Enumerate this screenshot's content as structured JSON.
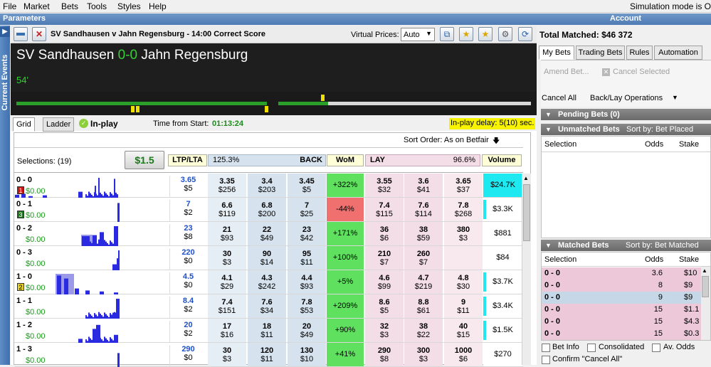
{
  "menu": {
    "items": [
      "File",
      "Market",
      "Bets",
      "Tools",
      "Styles",
      "Help"
    ],
    "simulation": "Simulation mode is O"
  },
  "header": {
    "parameters": "Parameters",
    "account": "Account"
  },
  "side": {
    "tab": "Current Events"
  },
  "market": {
    "title": "SV Sandhausen v Jahn Regensburg - 14:00 Correct Score",
    "virtual_prices_label": "Virtual Prices:",
    "virtual_prices_value": "Auto",
    "total_matched": "Total Matched: $46 372"
  },
  "score": {
    "home": "SV Sandhausen",
    "score": "0-0",
    "away": "Jahn Regensburg",
    "minute": "54'"
  },
  "tabs": {
    "grid": "Grid",
    "ladder": "Ladder",
    "inplay": "In-play",
    "time_label": "Time from Start:",
    "time_value": "01:13:24",
    "delay": "In-play delay: 5(10) sec."
  },
  "grid": {
    "sort_order": "Sort Order: As on Betfair",
    "selections": "Selections: (19)",
    "stake": "$1.5",
    "ltp": "LTP/LTA",
    "back_pct": "125.3%",
    "back": "BACK",
    "wom": "WoM",
    "lay": "LAY",
    "lay_pct": "96.6%",
    "volume": "Volume",
    "rows": [
      {
        "name": "0 - 0",
        "badge": "1",
        "badge_color": "#cc1111",
        "pl": "$0.00",
        "ltp": "3.65",
        "lta": "$5",
        "b": [
          [
            "3.35",
            "$256"
          ],
          [
            "3.4",
            "$203"
          ],
          [
            "3.45",
            "$5"
          ]
        ],
        "wom": "+322%",
        "wom_color": "#5fe05f",
        "l": [
          [
            "3.55",
            "$32"
          ],
          [
            "3.6",
            "$41"
          ],
          [
            "3.65",
            "$37"
          ]
        ],
        "vol": "$24.7K",
        "vol_hl": true,
        "vol_bar": 1.0
      },
      {
        "name": "0 - 1",
        "badge": "3",
        "badge_color": "#1a7a1a",
        "pl": "$0.00",
        "ltp": "7",
        "lta": "$2",
        "b": [
          [
            "6.6",
            "$119"
          ],
          [
            "6.8",
            "$200"
          ],
          [
            "7",
            "$25"
          ]
        ],
        "wom": "-44%",
        "wom_color": "#f07070",
        "l": [
          [
            "7.4",
            "$115"
          ],
          [
            "7.6",
            "$114"
          ],
          [
            "7.8",
            "$268"
          ]
        ],
        "vol": "$3.3K",
        "vol_hl": false,
        "vol_bar": 0.12
      },
      {
        "name": "0 - 2",
        "badge": "",
        "badge_color": "",
        "pl": "$0.00",
        "ltp": "23",
        "lta": "$8",
        "b": [
          [
            "21",
            "$93"
          ],
          [
            "22",
            "$49"
          ],
          [
            "23",
            "$42"
          ]
        ],
        "wom": "+171%",
        "wom_color": "#5fe05f",
        "l": [
          [
            "36",
            "$6"
          ],
          [
            "38",
            "$59"
          ],
          [
            "380",
            "$3"
          ]
        ],
        "vol": "$881",
        "vol_hl": false,
        "vol_bar": 0.03
      },
      {
        "name": "0 - 3",
        "badge": "",
        "badge_color": "",
        "pl": "$0.00",
        "ltp": "220",
        "lta": "$0",
        "b": [
          [
            "30",
            "$3"
          ],
          [
            "90",
            "$14"
          ],
          [
            "95",
            "$11"
          ]
        ],
        "wom": "+100%",
        "wom_color": "#5fe05f",
        "l": [
          [
            "210",
            "$7"
          ],
          [
            "260",
            "$7"
          ],
          [
            "",
            ""
          ]
        ],
        "vol": "$84",
        "vol_hl": false,
        "vol_bar": 0.0
      },
      {
        "name": "1 - 0",
        "badge": "2",
        "badge_color": "#e8d21a",
        "pl": "$0.00",
        "ltp": "4.5",
        "lta": "$0",
        "b": [
          [
            "4.1",
            "$29"
          ],
          [
            "4.3",
            "$242"
          ],
          [
            "4.4",
            "$93"
          ]
        ],
        "wom": "+5%",
        "wom_color": "#5fe05f",
        "l": [
          [
            "4.6",
            "$99"
          ],
          [
            "4.7",
            "$219"
          ],
          [
            "4.8",
            "$30"
          ]
        ],
        "vol": "$3.7K",
        "vol_hl": false,
        "vol_bar": 0.14
      },
      {
        "name": "1 - 1",
        "badge": "",
        "badge_color": "",
        "pl": "$0.00",
        "ltp": "8.4",
        "lta": "$2",
        "b": [
          [
            "7.4",
            "$151"
          ],
          [
            "7.6",
            "$34"
          ],
          [
            "7.8",
            "$53"
          ]
        ],
        "wom": "+209%",
        "wom_color": "#5fe05f",
        "l": [
          [
            "8.6",
            "$5"
          ],
          [
            "8.8",
            "$61"
          ],
          [
            "9",
            "$11"
          ]
        ],
        "vol": "$3.4K",
        "vol_hl": false,
        "vol_bar": 0.13
      },
      {
        "name": "1 - 2",
        "badge": "",
        "badge_color": "",
        "pl": "$0.00",
        "ltp": "20",
        "lta": "$2",
        "b": [
          [
            "17",
            "$16"
          ],
          [
            "18",
            "$11"
          ],
          [
            "20",
            "$49"
          ]
        ],
        "wom": "+90%",
        "wom_color": "#5fe05f",
        "l": [
          [
            "32",
            "$3"
          ],
          [
            "38",
            "$22"
          ],
          [
            "40",
            "$15"
          ]
        ],
        "vol": "$1.5K",
        "vol_hl": false,
        "vol_bar": 0.06
      },
      {
        "name": "1 - 3",
        "badge": "",
        "badge_color": "",
        "pl": "$0.00",
        "ltp": "290",
        "lta": "$0",
        "b": [
          [
            "30",
            "$3"
          ],
          [
            "120",
            "$11"
          ],
          [
            "130",
            "$10"
          ]
        ],
        "wom": "+41%",
        "wom_color": "#5fe05f",
        "l": [
          [
            "290",
            "$8"
          ],
          [
            "300",
            "$3"
          ],
          [
            "1000",
            "$6"
          ]
        ],
        "vol": "$270",
        "vol_hl": false,
        "vol_bar": 0.01
      }
    ]
  },
  "right": {
    "tabs": [
      "My Bets",
      "Trading Bets",
      "Rules",
      "Automation"
    ],
    "amend": "Amend Bet...",
    "cancel_selected": "Cancel Selected",
    "cancel_all": "Cancel All",
    "backlay_ops": "Back/Lay Operations",
    "pending": "Pending Bets (0)",
    "unmatched": "Unmatched Bets",
    "unmatched_sort": "Sort by: Bet Placed",
    "col_selection": "Selection",
    "col_odds": "Odds",
    "col_stake": "Stake",
    "matched": "Matched Bets",
    "matched_sort": "Sort by: Bet Matched",
    "matched_rows": [
      {
        "sel": "0 - 0",
        "odds": "3.6",
        "stake": "$10",
        "type": "lay"
      },
      {
        "sel": "0 - 0",
        "odds": "8",
        "stake": "$9",
        "type": "lay"
      },
      {
        "sel": "0 - 0",
        "odds": "9",
        "stake": "$9",
        "type": "back"
      },
      {
        "sel": "0 - 0",
        "odds": "15",
        "stake": "$1.1",
        "type": "lay"
      },
      {
        "sel": "0 - 0",
        "odds": "15",
        "stake": "$4.3",
        "type": "lay"
      },
      {
        "sel": "0 - 0",
        "odds": "15",
        "stake": "$0.3",
        "type": "lay"
      }
    ],
    "bet_info": "Bet Info",
    "consolidated": "Consolidated",
    "av_odds": "Av. Odds",
    "confirm_cancel": "Confirm \"Cancel All\""
  }
}
